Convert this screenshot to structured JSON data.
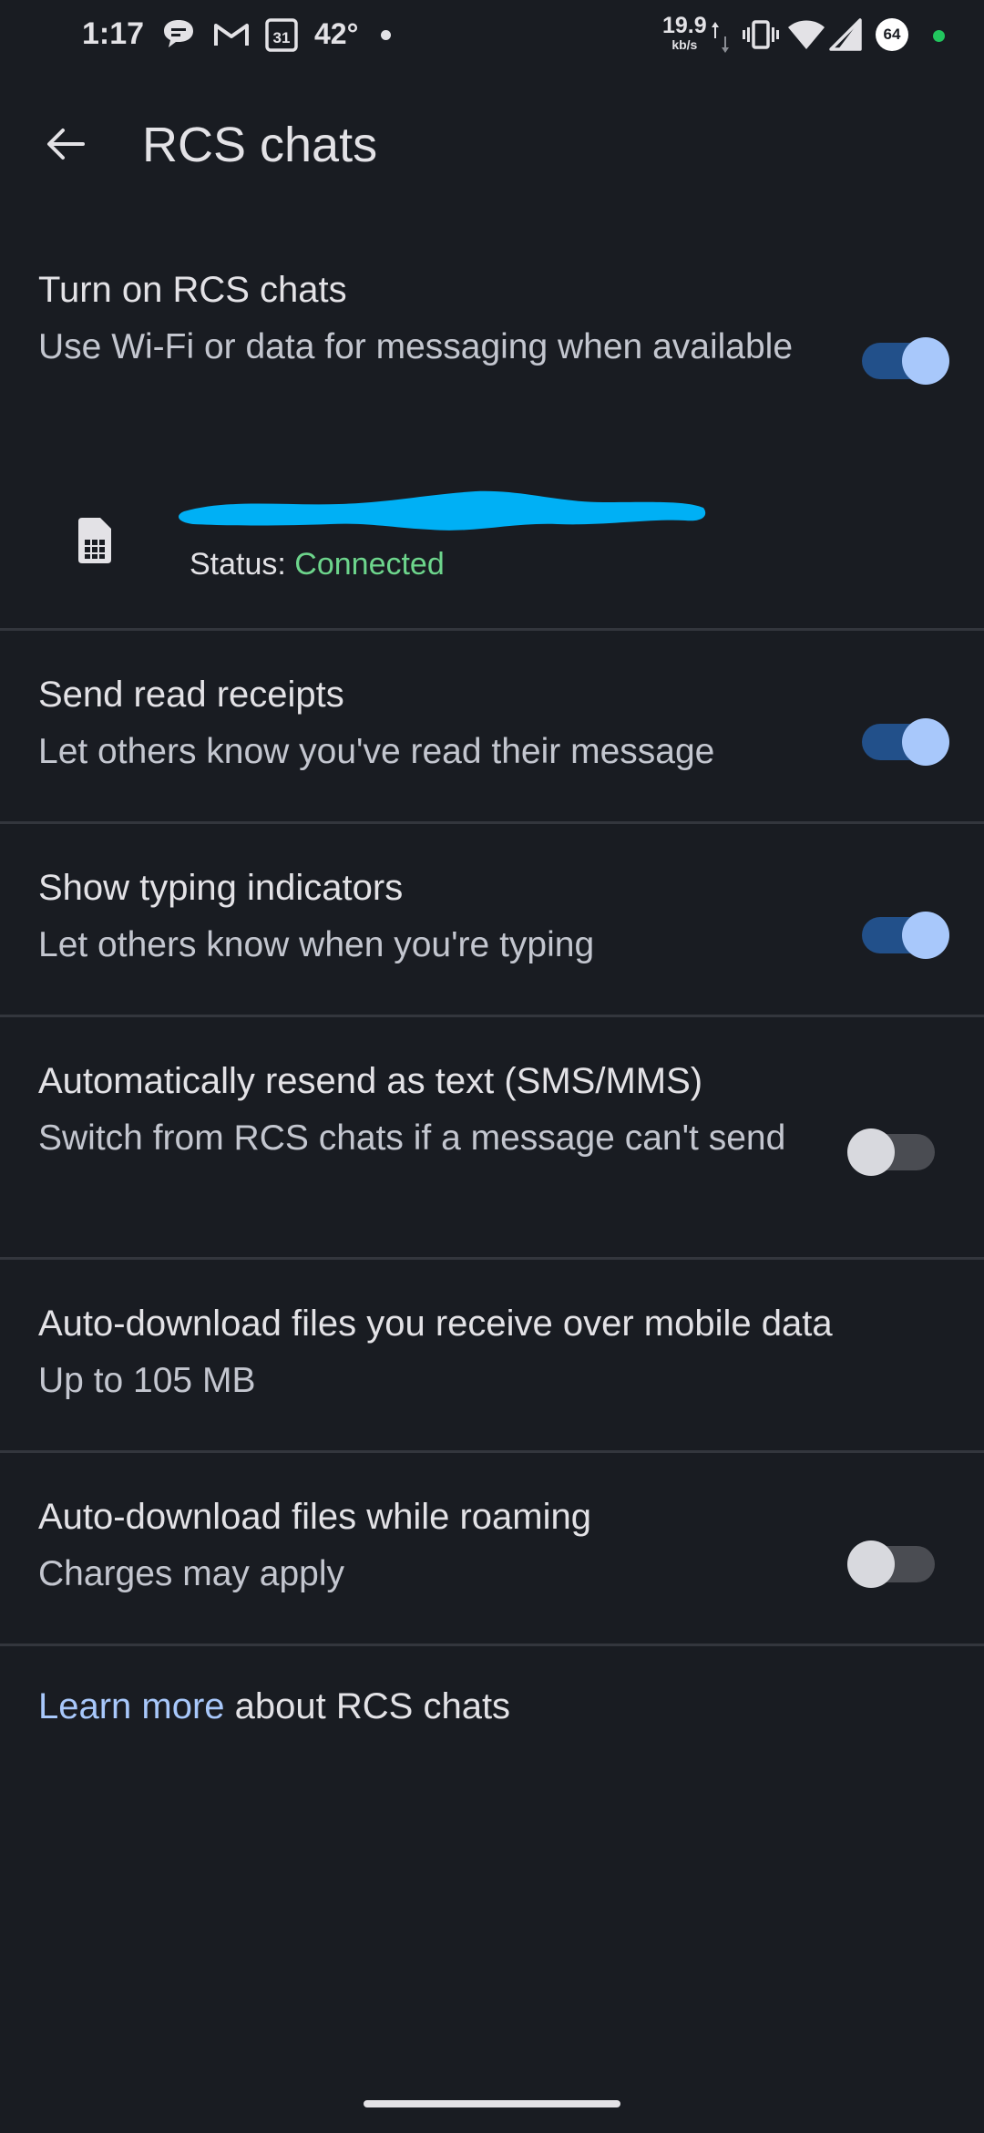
{
  "status_bar": {
    "time": "1:17",
    "temperature": "42°",
    "calendar_day": "31",
    "net_speed": "19.9",
    "net_speed_unit": "kb/s",
    "battery": "64"
  },
  "app_bar": {
    "title": "RCS chats",
    "back_icon": "arrow-back-icon"
  },
  "settings": {
    "rcs": {
      "title": "Turn on RCS chats",
      "subtitle": "Use Wi-Fi or data for messaging when available",
      "enabled": true
    },
    "sim": {
      "status_label": "Status:",
      "status_value": "Connected",
      "icon": "sim-card-icon"
    },
    "read_receipts": {
      "title": "Send read receipts",
      "subtitle": "Let others know you've read their message",
      "enabled": true
    },
    "typing": {
      "title": "Show typing indicators",
      "subtitle": "Let others know when you're typing",
      "enabled": true
    },
    "resend": {
      "title": "Automatically resend as text (SMS/MMS)",
      "subtitle": "Switch from RCS chats if a message can't send",
      "enabled": false
    },
    "auto_download_mobile": {
      "title": "Auto-download files you receive over mobile data",
      "subtitle": "Up to 105 MB"
    },
    "auto_download_roaming": {
      "title": "Auto-download files while roaming",
      "subtitle": "Charges may apply",
      "enabled": false
    }
  },
  "learn_more": {
    "link": "Learn more",
    "rest": " about RCS chats"
  },
  "colors": {
    "background": "#191c22",
    "accent": "#a8c8fb",
    "connected": "#6dd58c",
    "redaction": "#00b0f5"
  }
}
